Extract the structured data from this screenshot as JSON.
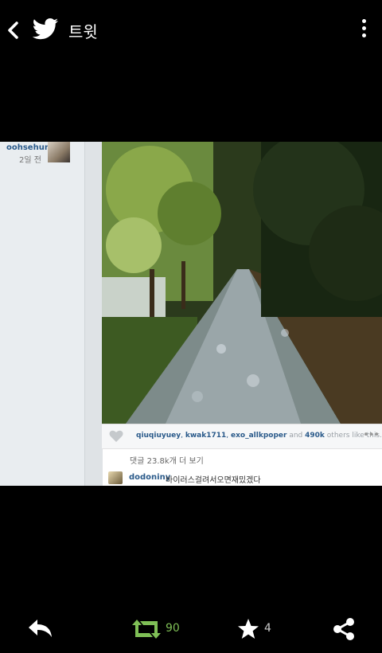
{
  "header": {
    "title": "트윗"
  },
  "post": {
    "username": "oohsehun",
    "time": "2일 전",
    "likes": {
      "user1": "qiuqiuyuey",
      "user2": "kwak1711",
      "user3": "exo_allkpoper",
      "and_text": "and",
      "count": "490k",
      "others_text": "others like this."
    },
    "comments_more": "댓글 23.8k개 더 보기",
    "comment": {
      "username": "dodoniny",
      "text": "바이러스걸려서오면재밌겠다"
    }
  },
  "actions": {
    "retweet_count": "90",
    "favorite_count": "4",
    "retweet_color": "#7fbf56"
  }
}
